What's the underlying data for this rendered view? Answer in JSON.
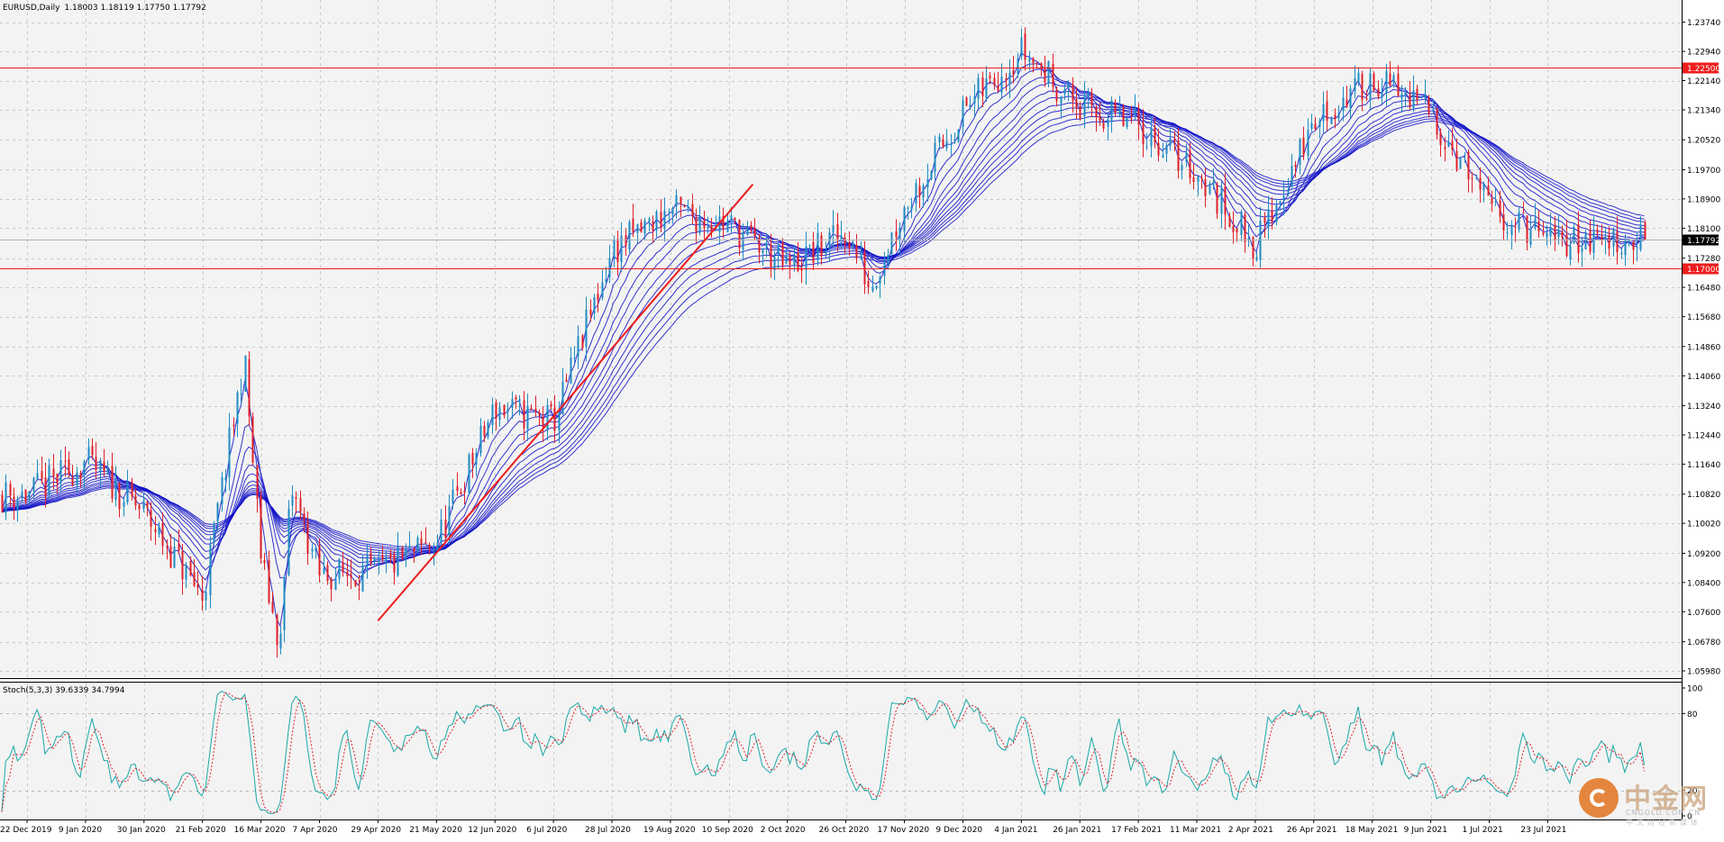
{
  "header": {
    "symbol": "EURUSD,Daily",
    "ohlc": "1.18003 1.18119 1.17750 1.17792"
  },
  "indicator": {
    "label": "Stoch(5,3,3) 39.6339 34.7994",
    "ticks": [
      {
        "label": "100",
        "value": 100
      },
      {
        "label": "80",
        "value": 80
      },
      {
        "label": "20",
        "value": 20
      },
      {
        "label": "0",
        "value": 0
      }
    ]
  },
  "watermark": {
    "name": "中金网",
    "url": "CNGOLD.COM.CN",
    "tagline": "中文财经新媒体"
  },
  "colors": {
    "candle_up": "#1f8bc4",
    "candle_down": "#e0202a",
    "ma": "#1010c8",
    "level": "#ee1c1c",
    "trend": "#ee1c1c",
    "stoch_main": "#1ba7a7",
    "stoch_signal": "#e0202a",
    "grid": "#c8c8c8"
  },
  "chart_data": {
    "type": "candlestick",
    "price_axis": {
      "range": [
        1.0598,
        1.2415
      ],
      "ticks": [
        "1.23740",
        "1.22940",
        "1.22140",
        "1.21340",
        "1.20520",
        "1.19700",
        "1.18900",
        "1.18100",
        "1.17280",
        "1.16480",
        "1.15680",
        "1.14860",
        "1.14060",
        "1.13240",
        "1.12440",
        "1.11640",
        "1.10820",
        "1.10020",
        "1.09200",
        "1.08400",
        "1.07600",
        "1.06780",
        "1.05980"
      ]
    },
    "time_axis": {
      "ticks": [
        "22 Dec 2019",
        "9 Jan 2020",
        "30 Jan 2020",
        "21 Feb 2020",
        "16 Mar 2020",
        "7 Apr 2020",
        "29 Apr 2020",
        "21 May 2020",
        "12 Jun 2020",
        "6 Jul 2020",
        "28 Jul 2020",
        "19 Aug 2020",
        "10 Sep 2020",
        "2 Oct 2020",
        "26 Oct 2020",
        "17 Nov 2020",
        "9 Dec 2020",
        "4 Jan 2021",
        "26 Jan 2021",
        "17 Feb 2021",
        "11 Mar 2021",
        "2 Apr 2021",
        "26 Apr 2021",
        "18 May 2021",
        "9 Jun 2021",
        "1 Jul 2021",
        "23 Jul 2021"
      ]
    },
    "price_path": [
      {
        "date": "22 Dec 2019",
        "price": 1.108
      },
      {
        "date": "9 Jan 2020",
        "price": 1.117
      },
      {
        "date": "30 Jan 2020",
        "price": 1.103
      },
      {
        "date": "21 Feb 2020",
        "price": 1.08
      },
      {
        "date": "9 Mar 2020",
        "price": 1.145
      },
      {
        "date": "16 Mar 2020",
        "price": 1.09
      },
      {
        "date": "23 Mar 2020",
        "price": 1.066
      },
      {
        "date": "27 Mar 2020",
        "price": 1.11
      },
      {
        "date": "7 Apr 2020",
        "price": 1.086
      },
      {
        "date": "29 Apr 2020",
        "price": 1.087
      },
      {
        "date": "21 May 2020",
        "price": 1.095
      },
      {
        "date": "12 Jun 2020",
        "price": 1.132
      },
      {
        "date": "6 Jul 2020",
        "price": 1.128
      },
      {
        "date": "28 Jul 2020",
        "price": 1.175
      },
      {
        "date": "19 Aug 2020",
        "price": 1.186
      },
      {
        "date": "10 Sep 2020",
        "price": 1.182
      },
      {
        "date": "2 Oct 2020",
        "price": 1.17
      },
      {
        "date": "26 Oct 2020",
        "price": 1.18
      },
      {
        "date": "4 Nov 2020",
        "price": 1.165
      },
      {
        "date": "17 Nov 2020",
        "price": 1.187
      },
      {
        "date": "9 Dec 2020",
        "price": 1.213
      },
      {
        "date": "4 Jan 2021",
        "price": 1.23
      },
      {
        "date": "26 Jan 2021",
        "price": 1.214
      },
      {
        "date": "17 Feb 2021",
        "price": 1.209
      },
      {
        "date": "11 Mar 2021",
        "price": 1.196
      },
      {
        "date": "2 Apr 2021",
        "price": 1.176
      },
      {
        "date": "26 Apr 2021",
        "price": 1.21
      },
      {
        "date": "18 May 2021",
        "price": 1.222
      },
      {
        "date": "9 Jun 2021",
        "price": 1.213
      },
      {
        "date": "1 Jul 2021",
        "price": 1.186
      },
      {
        "date": "23 Jul 2021",
        "price": 1.1779
      }
    ],
    "horizontal_levels": [
      {
        "price": 1.225,
        "label": "1.22500"
      },
      {
        "price": 1.17,
        "label": "1.17000"
      }
    ],
    "current_price": {
      "price": 1.17792,
      "label": "1.17792"
    },
    "trendline": {
      "from": {
        "date": "29 Apr 2020",
        "price": 1.0735
      },
      "to": {
        "date": "19 Sep 2020",
        "price": 1.193
      }
    },
    "moving_averages": {
      "count": 12
    },
    "stochastic": {
      "k": 39.6339,
      "d": 34.7994,
      "levels": [
        80,
        20
      ],
      "range": [
        0,
        100
      ]
    },
    "grid": "on"
  }
}
